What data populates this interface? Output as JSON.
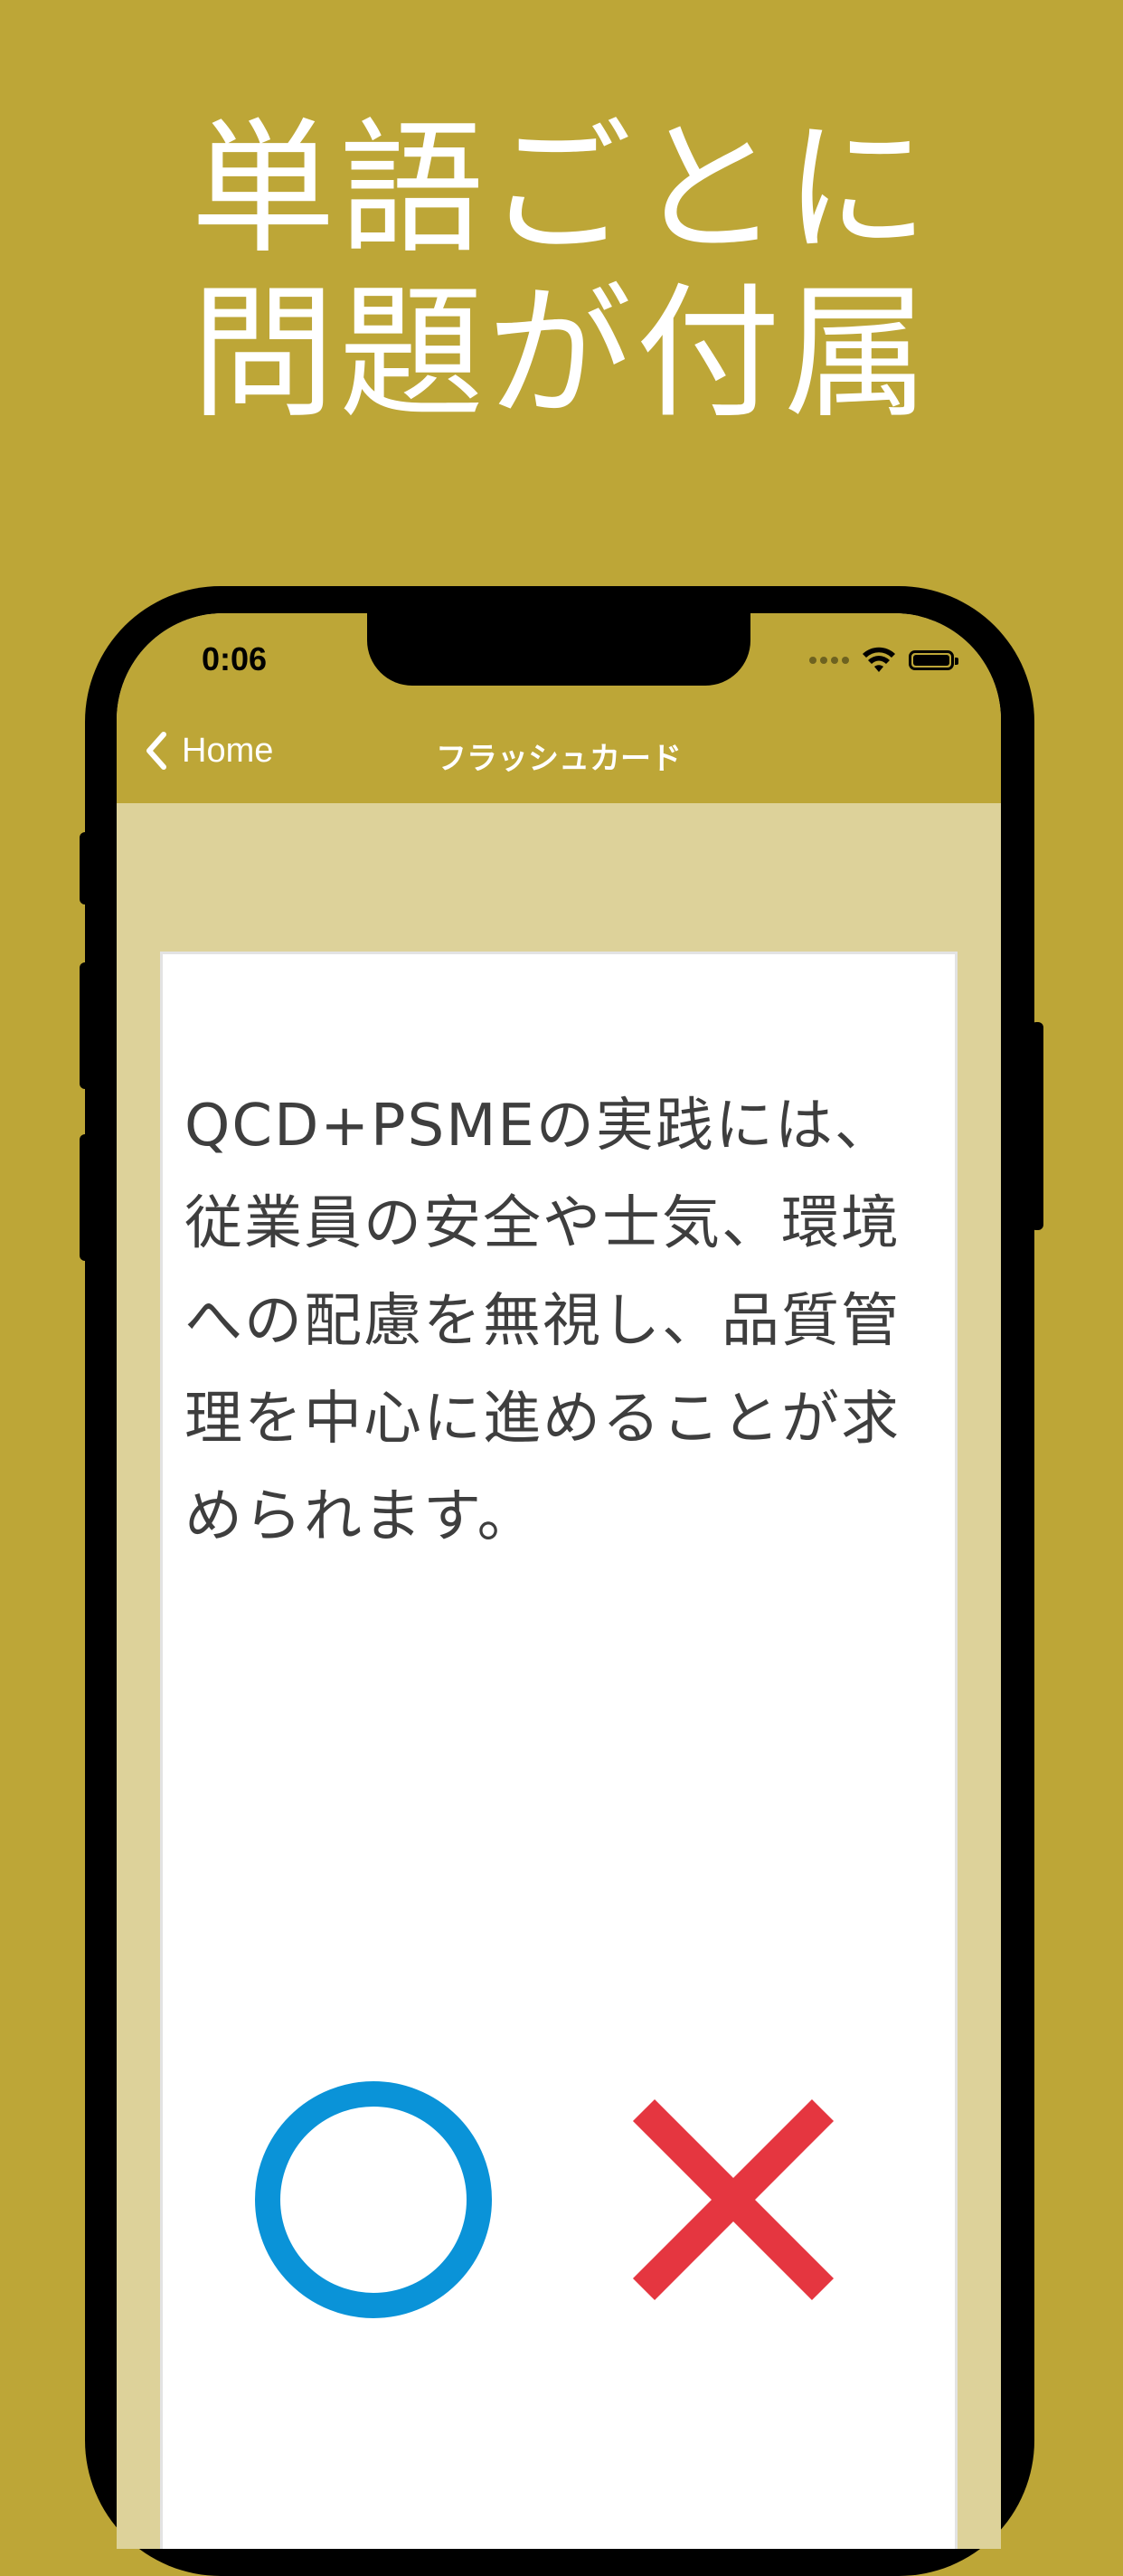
{
  "headline": {
    "line1": "単語ごとに",
    "line2": "問題が付属"
  },
  "status_bar": {
    "time": "0:06"
  },
  "nav": {
    "back_label": "Home",
    "title": "フラッシュカード"
  },
  "card": {
    "question": "QCD+PSMEの実践には、従業員の安全や士気、環境への配慮を無視し、品質管理を中心に進めることが求められます。"
  },
  "answers": {
    "true_icon": "circle-o-icon",
    "false_icon": "cross-x-icon",
    "true_color": "#0a93d8",
    "false_color": "#e53640"
  },
  "colors": {
    "background": "#bda637",
    "screen_background": "#ddd29a",
    "card_text": "#3e3e3e"
  }
}
